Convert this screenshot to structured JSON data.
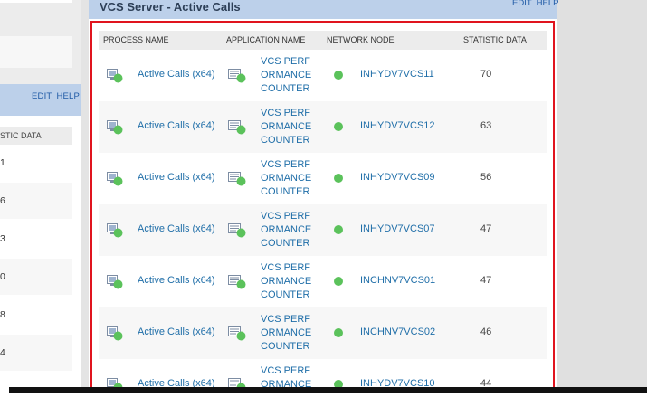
{
  "main_panel": {
    "title": "VCS Server - Active Calls",
    "links": {
      "edit": "EDIT",
      "help": "HELP"
    },
    "columns": [
      "PROCESS NAME",
      "APPLICATION NAME",
      "NETWORK NODE",
      "STATISTIC DATA"
    ],
    "rows": [
      {
        "process": "Active Calls (x64)",
        "application": "VCS PERFORMANCE COUNTER",
        "node": "INHYDV7VCS11",
        "value": "70",
        "status": "up"
      },
      {
        "process": "Active Calls (x64)",
        "application": "VCS PERFORMANCE COUNTER",
        "node": "INHYDV7VCS12",
        "value": "63",
        "status": "up"
      },
      {
        "process": "Active Calls (x64)",
        "application": "VCS PERFORMANCE COUNTER",
        "node": "INHYDV7VCS09",
        "value": "56",
        "status": "up"
      },
      {
        "process": "Active Calls (x64)",
        "application": "VCS PERFORMANCE COUNTER",
        "node": "INHYDV7VCS07",
        "value": "47",
        "status": "up"
      },
      {
        "process": "Active Calls (x64)",
        "application": "VCS PERFORMANCE COUNTER",
        "node": "INCHNV7VCS01",
        "value": "47",
        "status": "up"
      },
      {
        "process": "Active Calls (x64)",
        "application": "VCS PERFORMANCE COUNTER",
        "node": "INCHNV7VCS02",
        "value": "46",
        "status": "up"
      },
      {
        "process": "Active Calls (x64)",
        "application": "VCS PERFORMANCE COUNTER",
        "node": "INHYDV7VCS10",
        "value": "44",
        "status": "up"
      }
    ]
  },
  "left_panel": {
    "links": {
      "edit": "EDIT",
      "help": "HELP"
    },
    "column_header": "STIC DATA",
    "values": [
      "1",
      "6",
      "3",
      "0",
      "8",
      "4"
    ]
  },
  "colors": {
    "header_blue": "#bcd0ea",
    "link_blue": "#1f6ea8",
    "status_green": "#5bc25b",
    "highlight_red": "#e0141e"
  },
  "icons": {
    "process": "process-status-icon",
    "application": "application-monitor-icon",
    "node_status": "green-status-dot-icon"
  }
}
